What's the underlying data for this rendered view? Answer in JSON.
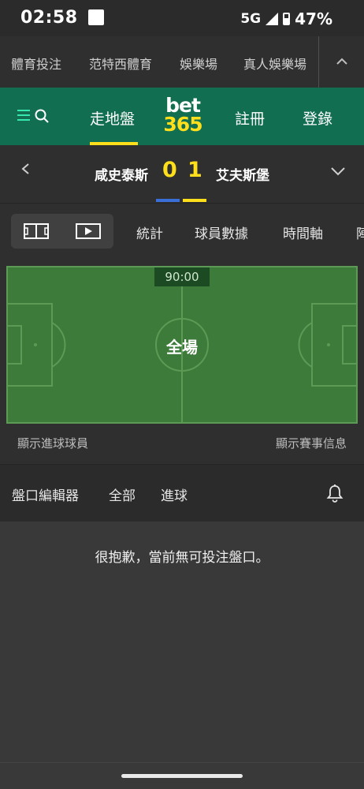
{
  "status_bar": {
    "time": "02:58",
    "network": "5G",
    "battery": "47%"
  },
  "category_nav": {
    "items": [
      "體育投注",
      "范特西體育",
      "娛樂場",
      "真人娛樂場"
    ]
  },
  "header": {
    "in_play_label": "走地盤",
    "logo_top": "bet",
    "logo_bottom": "365",
    "register_label": "註冊",
    "login_label": "登錄",
    "accent_color": "#ffdf1b",
    "brand_color": "#126e51"
  },
  "match": {
    "home_team": "咸史泰斯",
    "away_team": "艾夫斯堡",
    "home_score": "0",
    "away_score": "1",
    "home_color": "#3b6fd8",
    "away_color": "#ffdf1b"
  },
  "sub_tabs": {
    "items": [
      "統計",
      "球員數據",
      "時間軸",
      "陣"
    ]
  },
  "pitch": {
    "timer": "90:00",
    "status": "全場"
  },
  "links": {
    "show_scorers": "顯示進球球員",
    "show_match_info": "顯示賽事信息"
  },
  "filters": {
    "items": [
      "盤口編輯器",
      "全部",
      "進球"
    ]
  },
  "empty_message": "很抱歉，當前無可投注盤口。"
}
